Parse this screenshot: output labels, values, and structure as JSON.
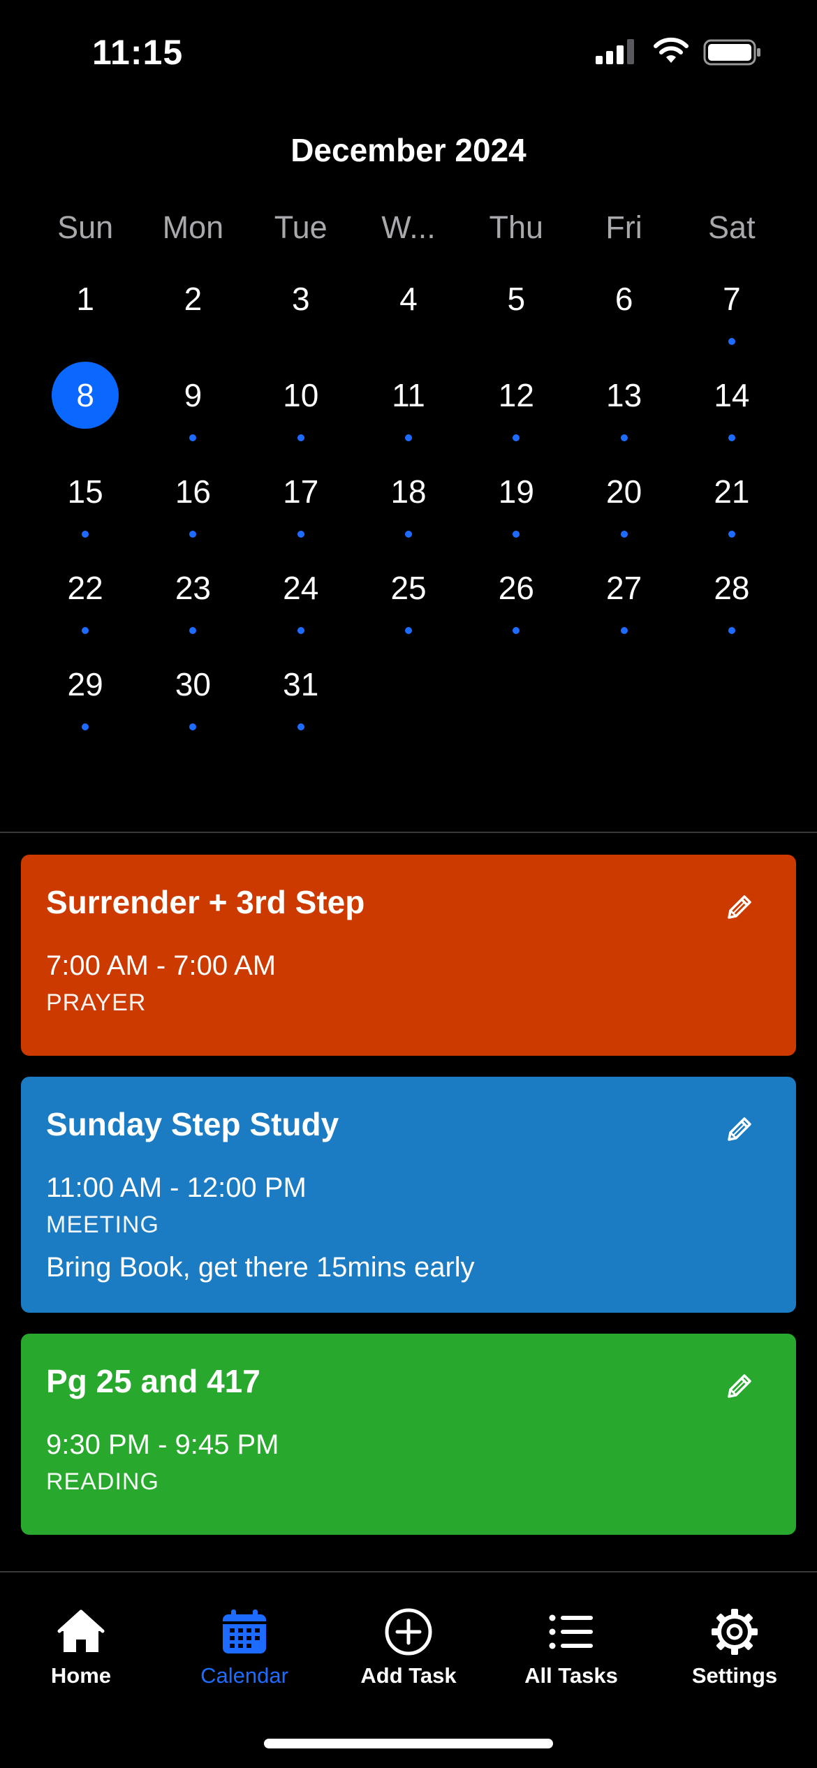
{
  "status": {
    "time": "11:15"
  },
  "calendar": {
    "month_title": "December 2024",
    "weekdays": [
      "Sun",
      "Mon",
      "Tue",
      "W...",
      "Thu",
      "Fri",
      "Sat"
    ],
    "selected_day": "8",
    "days": [
      {
        "n": "1",
        "dot": false
      },
      {
        "n": "2",
        "dot": false
      },
      {
        "n": "3",
        "dot": false
      },
      {
        "n": "4",
        "dot": false
      },
      {
        "n": "5",
        "dot": false
      },
      {
        "n": "6",
        "dot": false
      },
      {
        "n": "7",
        "dot": true
      },
      {
        "n": "8",
        "dot": false
      },
      {
        "n": "9",
        "dot": true
      },
      {
        "n": "10",
        "dot": true
      },
      {
        "n": "11",
        "dot": true
      },
      {
        "n": "12",
        "dot": true
      },
      {
        "n": "13",
        "dot": true
      },
      {
        "n": "14",
        "dot": true
      },
      {
        "n": "15",
        "dot": true
      },
      {
        "n": "16",
        "dot": true
      },
      {
        "n": "17",
        "dot": true
      },
      {
        "n": "18",
        "dot": true
      },
      {
        "n": "19",
        "dot": true
      },
      {
        "n": "20",
        "dot": true
      },
      {
        "n": "21",
        "dot": true
      },
      {
        "n": "22",
        "dot": true
      },
      {
        "n": "23",
        "dot": true
      },
      {
        "n": "24",
        "dot": true
      },
      {
        "n": "25",
        "dot": true
      },
      {
        "n": "26",
        "dot": true
      },
      {
        "n": "27",
        "dot": true
      },
      {
        "n": "28",
        "dot": true
      },
      {
        "n": "29",
        "dot": true
      },
      {
        "n": "30",
        "dot": true
      },
      {
        "n": "31",
        "dot": true
      }
    ]
  },
  "events": [
    {
      "title": "Surrender + 3rd Step",
      "time": "7:00 AM - 7:00 AM",
      "category": "PRAYER",
      "note": "",
      "color": "#cc3a00"
    },
    {
      "title": "Sunday Step Study",
      "time": "11:00 AM - 12:00 PM",
      "category": "MEETING",
      "note": "Bring Book, get there 15mins early",
      "color": "#1c7cc3"
    },
    {
      "title": "Pg 25 and 417",
      "time": "9:30 PM - 9:45 PM",
      "category": "READING",
      "note": "",
      "color": "#28a92e"
    }
  ],
  "tabs": [
    {
      "label": "Home",
      "icon": "house-icon",
      "active": false
    },
    {
      "label": "Calendar",
      "icon": "calendar-icon",
      "active": true
    },
    {
      "label": "Add Task",
      "icon": "plus-circle-icon",
      "active": false
    },
    {
      "label": "All Tasks",
      "icon": "list-icon",
      "active": false
    },
    {
      "label": "Settings",
      "icon": "gear-icon",
      "active": false
    }
  ],
  "colors": {
    "accent": "#1e6cff",
    "selected_day": "#0a68ff"
  }
}
